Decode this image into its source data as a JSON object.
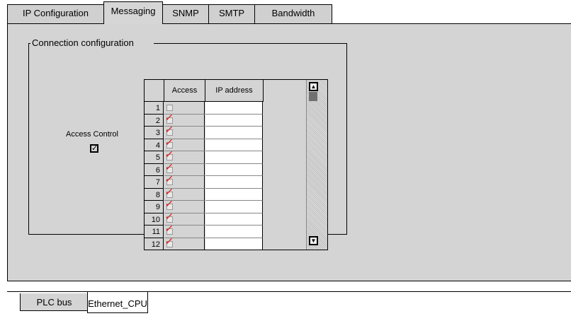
{
  "tabs": [
    {
      "label": "IP  Configuration",
      "active": false
    },
    {
      "label": "Messaging",
      "active": true
    },
    {
      "label": "SNMP",
      "active": false
    },
    {
      "label": "SMTP",
      "active": false
    },
    {
      "label": "Bandwidth",
      "active": false
    }
  ],
  "connection": {
    "group_title": "Connection configuration",
    "access_control_label": "Access Control",
    "access_control_checked": true
  },
  "table": {
    "columns": [
      "Access",
      "IP address"
    ],
    "rows": [
      {
        "num": "1",
        "access": false,
        "ip": ""
      },
      {
        "num": "2",
        "access": true,
        "ip": ""
      },
      {
        "num": "3",
        "access": true,
        "ip": ""
      },
      {
        "num": "4",
        "access": true,
        "ip": ""
      },
      {
        "num": "5",
        "access": true,
        "ip": ""
      },
      {
        "num": "6",
        "access": true,
        "ip": ""
      },
      {
        "num": "7",
        "access": true,
        "ip": ""
      },
      {
        "num": "8",
        "access": true,
        "ip": ""
      },
      {
        "num": "9",
        "access": true,
        "ip": ""
      },
      {
        "num": "10",
        "access": true,
        "ip": ""
      },
      {
        "num": "11",
        "access": true,
        "ip": ""
      },
      {
        "num": "12",
        "access": true,
        "ip": ""
      }
    ]
  },
  "bottom_tabs": [
    {
      "label": "PLC bus",
      "active": false
    },
    {
      "label": "Ethernet_CPU",
      "active": true
    }
  ],
  "colors": {
    "panel_bg": "#d4d4d4",
    "check_red": "#e01010"
  }
}
